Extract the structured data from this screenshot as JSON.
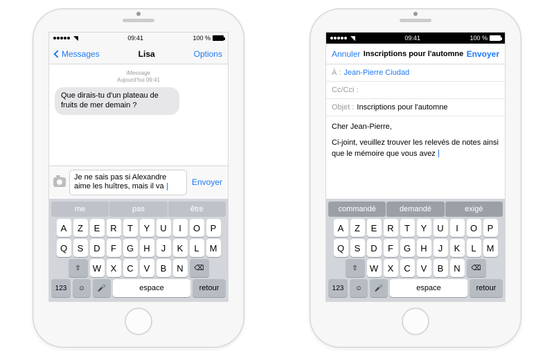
{
  "status": {
    "time": "09:41",
    "carrier_wifi": "",
    "battery_pct": "100 %"
  },
  "left": {
    "nav": {
      "back": "Messages",
      "title": "Lisa",
      "options": "Options"
    },
    "thread": {
      "service": "iMessage",
      "timestamp": "Aujourd'hui 09:41",
      "incoming": "Que dirais-tu d'un plateau de fruits de mer demain ?"
    },
    "compose": {
      "draft": "Je ne sais pas si Alexandre aime les huîtres, mais il va ",
      "send": "Envoyer"
    },
    "predict": [
      "me",
      "pas",
      "être"
    ]
  },
  "right": {
    "nav": {
      "cancel": "Annuler",
      "title": "Inscriptions pour l'automne",
      "send": "Envoyer"
    },
    "fields": {
      "to_label": "À :",
      "to_value": "Jean-Pierre Ciudad",
      "cc_label": "Cc/Cci :",
      "subject_label": "Objet :",
      "subject_value": "Inscriptions pour l'automne"
    },
    "body_line1": "Cher Jean-Pierre,",
    "body_line2": "Ci-joint, veuillez trouver les relevés de notes ainsi que le mémoire que vous avez ",
    "predict": [
      "commandé",
      "demandé",
      "exigé"
    ]
  },
  "keyboard": {
    "row1": [
      "A",
      "Z",
      "E",
      "R",
      "T",
      "Y",
      "U",
      "I",
      "O",
      "P"
    ],
    "row2": [
      "Q",
      "S",
      "D",
      "F",
      "G",
      "H",
      "J",
      "K",
      "L",
      "M"
    ],
    "row3": [
      "W",
      "X",
      "C",
      "V",
      "B",
      "N"
    ],
    "n123": "123",
    "space": "espace",
    "ret": "retour"
  }
}
